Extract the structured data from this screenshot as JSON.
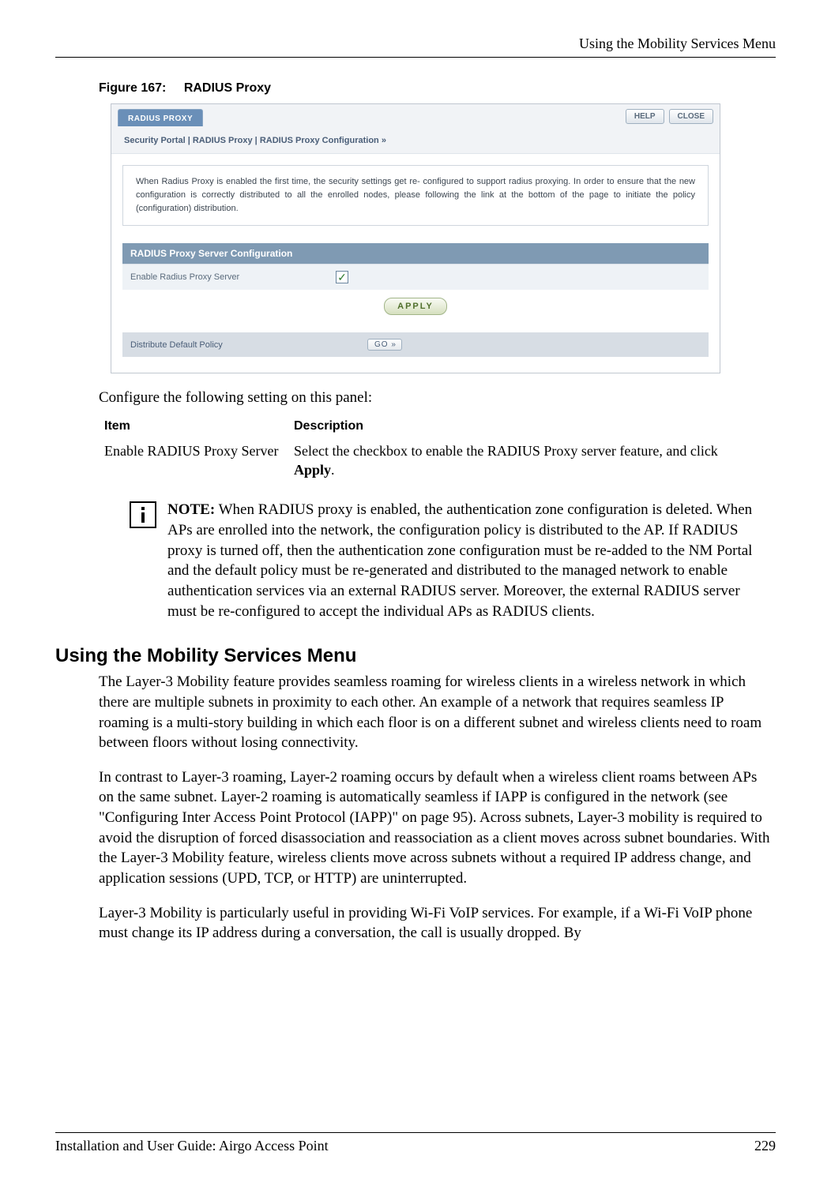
{
  "header": {
    "running": "Using the Mobility Services Menu"
  },
  "figure": {
    "label": "Figure 167:",
    "title": "RADIUS Proxy"
  },
  "screenshot": {
    "tab": "RADIUS PROXY",
    "help_btn": "HELP",
    "close_btn": "CLOSE",
    "breadcrumb": "Security Portal | RADIUS Proxy | RADIUS Proxy Configuration  »",
    "info": "When Radius Proxy is enabled the first time, the security settings get re- configured to support radius proxying. In order to ensure that the new configuration is correctly distributed to all the enrolled nodes, please following the link at the bottom of the page to initiate the policy (configuration) distribution.",
    "section_head": "RADIUS Proxy Server Configuration",
    "row1_label": "Enable Radius Proxy Server",
    "apply": "APPLY",
    "row2_label": "Distribute Default Policy",
    "go": "GO »"
  },
  "config_intro": "Configure the following setting on this panel:",
  "table": {
    "head_item": "Item",
    "head_desc": "Description",
    "row_item": "Enable RADIUS Proxy Server",
    "row_desc_a": "Select the checkbox to enable the RADIUS Proxy server feature, and click ",
    "row_desc_b": "Apply",
    "row_desc_c": "."
  },
  "note": {
    "label": "NOTE:",
    "text": " When RADIUS proxy is enabled, the authentication zone configuration is deleted. When APs are enrolled into the network, the configuration policy is distributed to the AP. If RADIUS proxy is turned off, then the authentication zone configuration must be re-added to the NM Portal and the default policy must be re-generated and distributed to the managed network to enable authentication services via an external RADIUS server. Moreover, the external RADIUS server must be re-configured to accept the individual APs as RADIUS clients."
  },
  "section": {
    "heading": "Using the Mobility Services Menu",
    "p1": "The Layer-3 Mobility feature provides seamless roaming for wireless clients in a wireless network in which there are multiple subnets in proximity to each other. An example of a network that requires seamless IP roaming is a multi-story building in which each floor is on a different subnet and wireless clients need to roam between floors without losing connectivity.",
    "p2": "In contrast to Layer-3 roaming, Layer-2 roaming occurs by default when a wireless client roams between APs on the same subnet. Layer-2 roaming is automatically seamless if IAPP is configured in the network (see \"Configuring Inter Access Point Protocol (IAPP)\" on page 95). Across subnets, Layer-3 mobility is required to avoid the disruption of forced disassociation and reassociation as a client moves across subnet boundaries. With the Layer-3 Mobility feature, wireless clients move across subnets without a required IP address change, and application sessions (UPD, TCP, or HTTP) are uninterrupted.",
    "p3": "Layer-3 Mobility is particularly useful in providing Wi-Fi VoIP services. For example, if a Wi-Fi VoIP phone must change its IP address during a conversation, the call is usually dropped. By"
  },
  "footer": {
    "left": "Installation and User Guide: Airgo Access Point",
    "right": "229"
  }
}
